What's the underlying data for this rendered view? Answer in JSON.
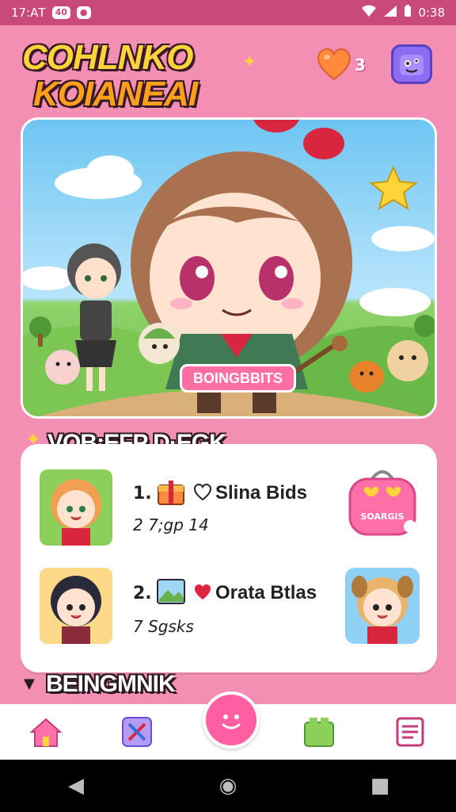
{
  "status_bar": {
    "time": "17:АТ",
    "badge_a": "40",
    "badge_b": "●",
    "clock_right": "0:38"
  },
  "header": {
    "logo_line1": "COHLNKO",
    "logo_line2": "KOIANEAI",
    "hearts_count": "3",
    "heart_color": "#ff8a3d",
    "mascot_icon": "purple-monster-icon"
  },
  "hero": {
    "banner_label": "BOINGBBITS"
  },
  "section_list": {
    "title": "VOB:EFP D·EGK",
    "items": [
      {
        "rank": "1.",
        "name": "Slina Bids",
        "meta": "2 7;gp 14",
        "side_badge": "SOARGIS"
      },
      {
        "rank": "2.",
        "name": "Orata Btlas",
        "meta": "7 Sgsks"
      }
    ]
  },
  "section_next": {
    "title": "BEINGMNIK"
  },
  "bottom_nav": {
    "items": [
      "home-icon",
      "tools-icon",
      "smile-icon",
      "block-icon",
      "notes-icon"
    ]
  }
}
